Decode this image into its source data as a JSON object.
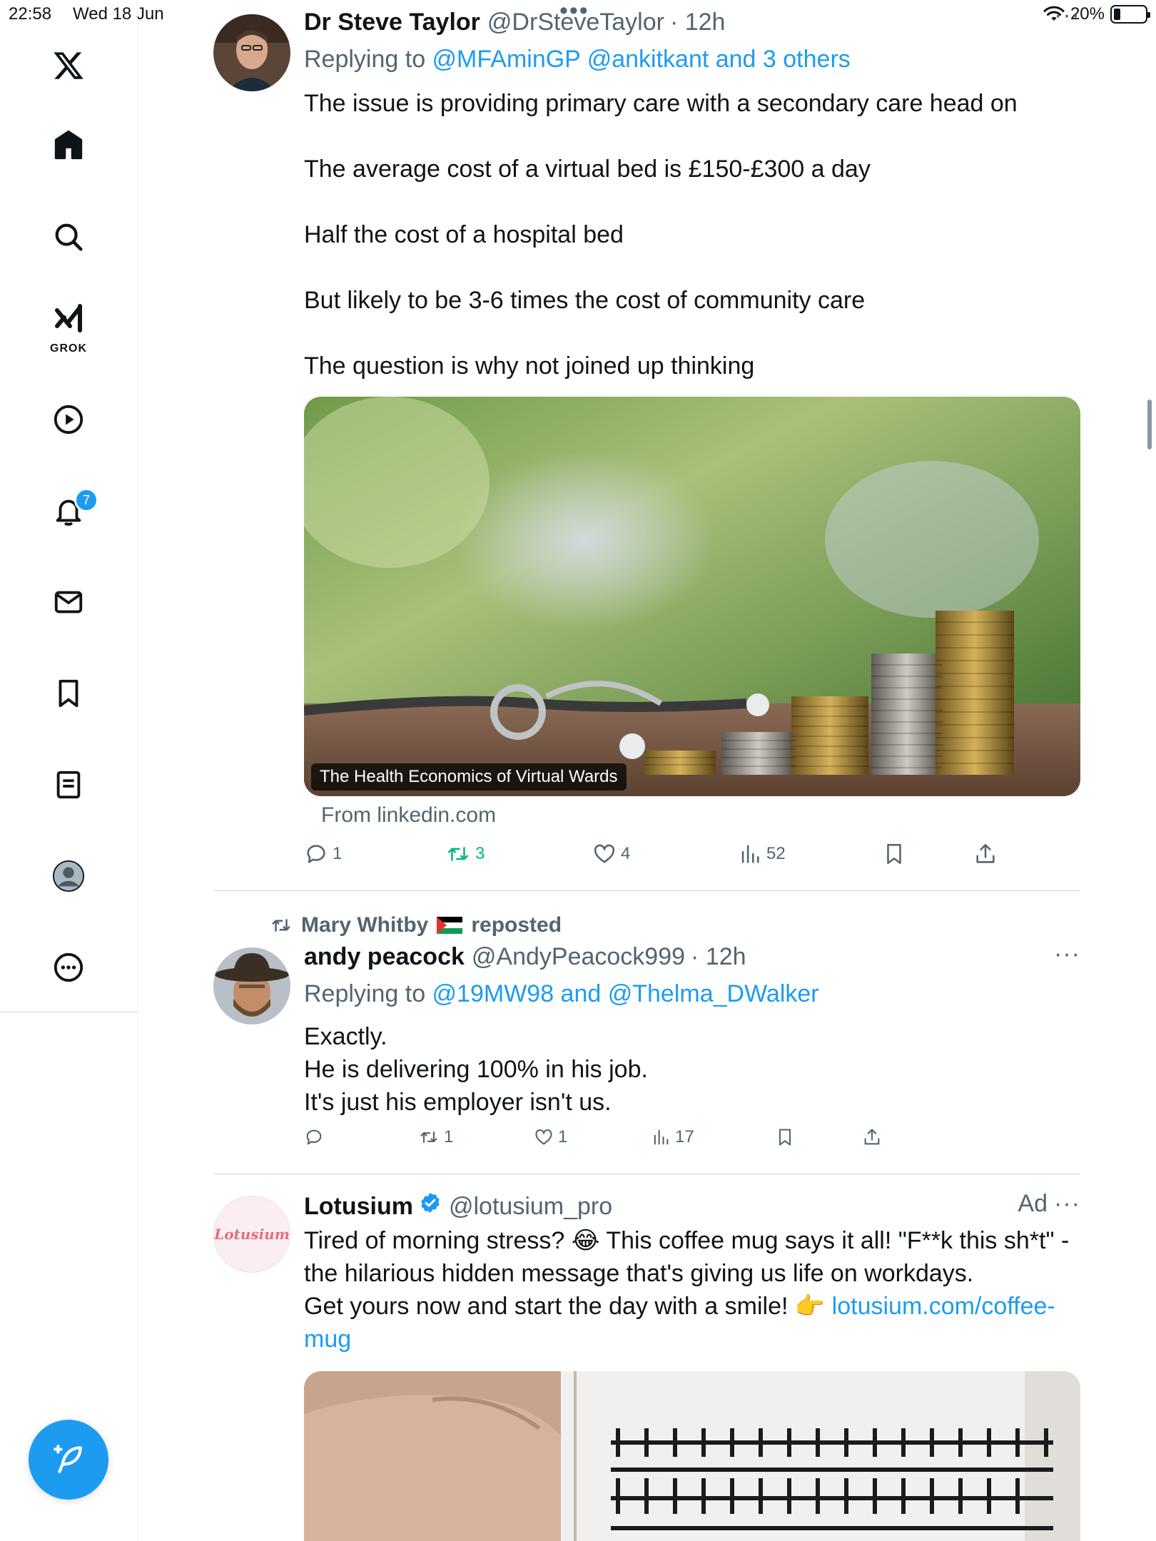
{
  "status_bar": {
    "time": "22:58",
    "date": "Wed 18 Jun",
    "battery_percent": "20%",
    "battery_level": 0.2
  },
  "sidebar": {
    "items": [
      {
        "name": "x-logo",
        "icon": "x-logo-icon"
      },
      {
        "name": "home",
        "icon": "home-icon"
      },
      {
        "name": "explore",
        "icon": "search-icon"
      },
      {
        "name": "grok",
        "icon": "grok-icon",
        "label": "GROK"
      },
      {
        "name": "videos",
        "icon": "play-icon"
      },
      {
        "name": "notifications",
        "icon": "bell-icon",
        "badge": "7"
      },
      {
        "name": "messages",
        "icon": "mail-icon"
      },
      {
        "name": "bookmarks",
        "icon": "bookmark-icon"
      },
      {
        "name": "articles",
        "icon": "document-icon"
      },
      {
        "name": "profile",
        "icon": "avatar-icon"
      },
      {
        "name": "more",
        "icon": "more-circle-icon"
      }
    ],
    "compose_icon": "compose-feather-icon"
  },
  "tweets": [
    {
      "display_name": "Dr Steve Taylor",
      "handle": "@DrSteveTaylor",
      "time": "· 12h",
      "replying_prefix": "Replying to ",
      "replying_mentions": "@MFAminGP @ankitkant and 3 others",
      "text": "The issue is providing primary care with a secondary care head on\n\nThe average cost of a virtual bed is £150-£300 a day\n\nHalf the cost of a hospital bed\n\nBut likely to be 3-6 times the cost of community care\n\nThe question is why not joined up thinking",
      "card": {
        "caption": "The Health Economics of Virtual Wards",
        "source": "From linkedin.com"
      },
      "actions": {
        "replies": "1",
        "reposts": "3",
        "likes": "4",
        "views": "52"
      }
    },
    {
      "repost_by": "Mary Whitby",
      "repost_suffix": "reposted",
      "display_name": "andy peacock",
      "handle": "@AndyPeacock999",
      "time": "· 12h",
      "replying_prefix": "Replying to ",
      "replying_mentions": "@19MW98 and @Thelma_DWalker",
      "text": "Exactly.\nHe is delivering 100% in his job.\nIt's just his employer isn't us.",
      "actions": {
        "replies": "",
        "reposts": "1",
        "likes": "1",
        "views": "17"
      }
    },
    {
      "display_name": "Lotusium",
      "handle": "@lotusium_pro",
      "ad_label": "Ad",
      "avatar_text": "Lotusium",
      "text_main": "Tired of morning stress? 😂 This coffee mug says it all! \"F**k this sh*t\" - the hilarious hidden message that's giving us life on workdays.\nGet yours now and start the day with a smile! 👉 ",
      "link": "lotusium.com/coffee-mug"
    }
  ],
  "colors": {
    "accent": "#1d9bf0",
    "repost_active": "#00ba7c",
    "secondary_text": "#536471"
  }
}
